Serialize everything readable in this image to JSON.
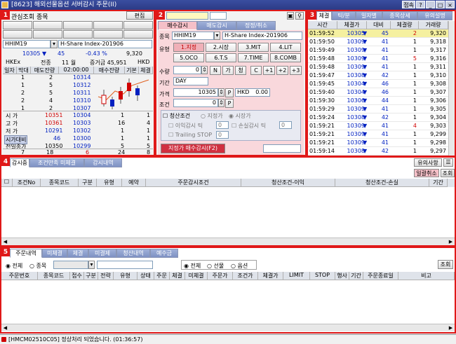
{
  "window": {
    "title": "[8623] 해외선물옵션 서버감시 주문(II)",
    "buttons": [
      "접속",
      "?",
      "_",
      "□",
      "×"
    ]
  },
  "panel1": {
    "badge": "1",
    "header": "관심조회 종목",
    "edit_label": "편집",
    "symbol": "HHIM19",
    "symbol_name": "H-Share Index-201906",
    "price": "10305",
    "arrow": "▼",
    "change": "45",
    "change_pct": "-0.43 %",
    "volume": "9,320",
    "exchange": "HKEx",
    "prev_day_label": "전종",
    "month_label": "11 월",
    "margin_label": "증거금 45,951",
    "currency": "HKD",
    "tabs": [
      "일자",
      "막대",
      "매도잔량",
      "02:00:00",
      "매수잔량",
      "기본",
      "체결"
    ],
    "asks": [
      {
        "qty": "1",
        "cnt": "2",
        "price": "10314"
      },
      {
        "qty": "1",
        "cnt": "5",
        "price": "10312"
      },
      {
        "qty": "2",
        "cnt": "5",
        "price": "10311"
      },
      {
        "qty": "2",
        "cnt": "4",
        "price": "10310"
      },
      {
        "qty": "1",
        "cnt": "2",
        "price": "10307"
      }
    ],
    "bids": [
      {
        "label": "시  가",
        "lval": "10351",
        "price": "10304",
        "cnt": "1",
        "qty": "1"
      },
      {
        "label": "고  가",
        "lval": "10361",
        "price": "10303",
        "cnt": "16",
        "qty": "4"
      },
      {
        "label": "저  가",
        "lval": "10291",
        "price": "10302",
        "cnt": "1",
        "qty": "1"
      },
      {
        "label": "시가대비",
        "lval": "46",
        "price": "10300",
        "cnt": "1",
        "qty": "1"
      },
      {
        "label": "전일종가",
        "lval": "10350",
        "price": "10299",
        "cnt": "5",
        "qty": "5"
      }
    ],
    "totals": {
      "ask_cnt": "7",
      "ask_qty": "18",
      "diff": "6",
      "bid_qty": "24",
      "bid_cnt": "8"
    }
  },
  "panel2": {
    "badge": "2",
    "tabs": [
      "매수감시",
      "매도감시",
      "정정/취소"
    ],
    "symbol_label": "종목",
    "symbol": "HHIM19",
    "symbol_name": "H-Share Index-201906",
    "type_label": "유형",
    "types": [
      "1.지정",
      "2.시장",
      "3.MIT",
      "4.LIT",
      "5.OCO",
      "6.T.S",
      "7.TIME",
      "8.COMB"
    ],
    "qty_label": "수량",
    "qty": "0",
    "qty_btns": [
      "N",
      "가",
      "청",
      "C",
      "+1",
      "+2",
      "+3"
    ],
    "period_label": "기간",
    "period": "DAY",
    "price_label": "가격",
    "price": "10305",
    "p_label": "P",
    "currency": "HKD",
    "currency_val": "0.00",
    "cond_label": "조건",
    "cond_val": "0",
    "liq_label": "청산조건",
    "spec_label": "지정가",
    "market_label": "시장가",
    "profit_label": "이익감시 틱",
    "profit_val": "0",
    "loss_label": "손실감시 틱",
    "loss_val": "0",
    "trail_label": "Trailing STOP",
    "trail_val": "0",
    "submit": "지정가 매수감시(F2)"
  },
  "panel3": {
    "badge": "3",
    "tabs": [
      "체결",
      "틱/분",
      "일자별",
      "종목상세",
      "유의설명"
    ],
    "headers": [
      "시간",
      "체결가",
      "대비",
      "체결량",
      "거래량"
    ],
    "rows": [
      {
        "time": "01:59:52",
        "price": "10305",
        "diff": "45",
        "qty": "2",
        "vol": "9,320",
        "sel": true
      },
      {
        "time": "01:59:50",
        "price": "10309",
        "diff": "41",
        "qty": "1",
        "vol": "9,318"
      },
      {
        "time": "01:59:49",
        "price": "10309",
        "diff": "41",
        "qty": "1",
        "vol": "9,317"
      },
      {
        "time": "01:59:48",
        "price": "10309",
        "diff": "41",
        "qty": "5",
        "vol": "9,316"
      },
      {
        "time": "01:59:48",
        "price": "10309",
        "diff": "41",
        "qty": "1",
        "vol": "9,311"
      },
      {
        "time": "01:59:47",
        "price": "10308",
        "diff": "42",
        "qty": "1",
        "vol": "9,310"
      },
      {
        "time": "01:59:45",
        "price": "10304",
        "diff": "46",
        "qty": "1",
        "vol": "9,308"
      },
      {
        "time": "01:59:40",
        "price": "10304",
        "diff": "46",
        "qty": "1",
        "vol": "9,307"
      },
      {
        "time": "01:59:30",
        "price": "10306",
        "diff": "44",
        "qty": "1",
        "vol": "9,306"
      },
      {
        "time": "01:59:29",
        "price": "10309",
        "diff": "41",
        "qty": "1",
        "vol": "9,305"
      },
      {
        "time": "01:59:24",
        "price": "10308",
        "diff": "42",
        "qty": "1",
        "vol": "9,304"
      },
      {
        "time": "01:59:21",
        "price": "10309",
        "diff": "41",
        "qty": "4",
        "vol": "9,303"
      },
      {
        "time": "01:59:21",
        "price": "10309",
        "diff": "41",
        "qty": "1",
        "vol": "9,299"
      },
      {
        "time": "01:59:21",
        "price": "10309",
        "diff": "41",
        "qty": "1",
        "vol": "9,298"
      },
      {
        "time": "01:59:14",
        "price": "10308",
        "diff": "42",
        "qty": "1",
        "vol": "9,297"
      }
    ]
  },
  "panel4": {
    "badge": "4",
    "tabs": [
      "감시중",
      "조건만족 미체결",
      "감시내역"
    ],
    "help_label": "유의사항",
    "cancel_label": "일괄취소",
    "query_label": "조회",
    "headers": [
      "조건No",
      "종목코드",
      "구분",
      "유형",
      "예약",
      "주문감시조건",
      "청산조건-이익",
      "청산조건-손실",
      "기간"
    ]
  },
  "panel5": {
    "badge": "5",
    "tabs": [
      "주문내역",
      "미체결",
      "체결",
      "미결제",
      "청산내역",
      "예수금"
    ],
    "radio_all": "전체",
    "radio_symbol": "종목",
    "radio2_all": "전체",
    "radio2_fut": "선물",
    "radio2_opt": "옵션",
    "query_label": "조회",
    "headers": [
      "주문번호",
      "종목코드",
      "접수",
      "구분",
      "전략",
      "유형",
      "상태",
      "주문",
      "체결",
      "미체결",
      "주문가",
      "조건가",
      "체결가",
      "LIMIT",
      "STOP",
      "행사",
      "기간",
      "주문종료일",
      "비고"
    ]
  },
  "status": {
    "text": "[HMCM02510C05] 정상처리 되었습니다. (01:36:57)"
  }
}
